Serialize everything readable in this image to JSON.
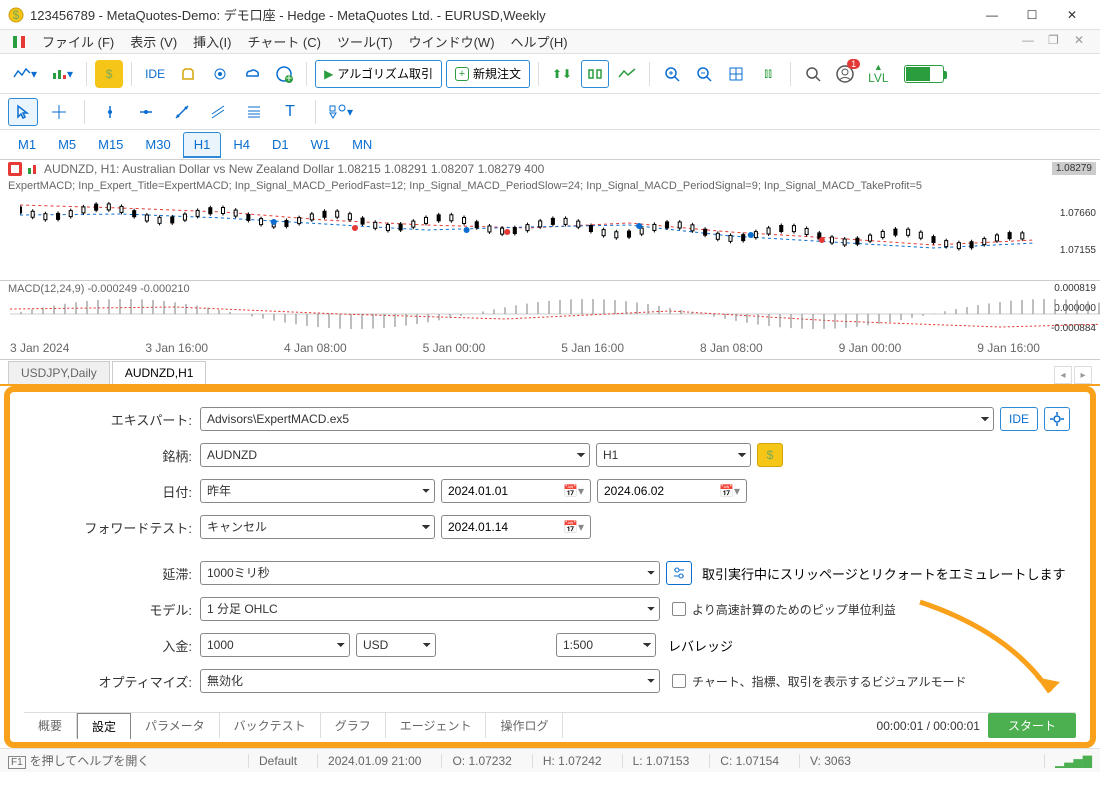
{
  "window": {
    "title": "123456789 - MetaQuotes-Demo: デモ口座 - Hedge - MetaQuotes Ltd. - EURUSD,Weekly"
  },
  "menu": {
    "file": "ファイル (F)",
    "view": "表示 (V)",
    "insert": "挿入(I)",
    "chart": "チャート (C)",
    "tool": "ツール(T)",
    "window": "ウインドウ(W)",
    "help": "ヘルプ(H)"
  },
  "toolbar": {
    "ide": "IDE",
    "algo": "アルゴリズム取引",
    "neworder": "新規注文",
    "notif_count": "1"
  },
  "timeframes": [
    "M1",
    "M5",
    "M15",
    "M30",
    "H1",
    "H4",
    "D1",
    "W1",
    "MN"
  ],
  "tf_active": "H1",
  "chart": {
    "header": "AUDNZD, H1:  Australian Dollar vs New Zealand Dollar  1.08215 1.08291 1.08207 1.08279  400",
    "expert_line": "ExpertMACD; Inp_Expert_Title=ExpertMACD; Inp_Signal_MACD_PeriodFast=12; Inp_Signal_MACD_PeriodSlow=24; Inp_Signal_MACD_PeriodSignal=9; Inp_Signal_MACD_TakeProfit=5",
    "price_hl": "1.08279",
    "price_2": "1.07660",
    "price_3": "1.07155",
    "macd_label": "MACD(12,24,9) -0.000249 -0.000210",
    "macd_v1": "0.000819",
    "macd_v2": "0.000000",
    "macd_v3": "-0.000884",
    "time_ticks": [
      "3 Jan 2024",
      "3 Jan 16:00",
      "4 Jan 08:00",
      "5 Jan 00:00",
      "5 Jan 16:00",
      "8 Jan 08:00",
      "9 Jan 00:00",
      "9 Jan 16:00"
    ]
  },
  "chart_tabs": {
    "inactive": "USDJPY,Daily",
    "active": "AUDNZD,H1"
  },
  "form": {
    "labels": {
      "expert": "エキスパート:",
      "symbol": "銘柄:",
      "date": "日付:",
      "forward": "フォワードテスト:",
      "delay": "延滞:",
      "model": "モデル:",
      "deposit": "入金:",
      "leverage": "レバレッジ",
      "optimize": "オプティマイズ:"
    },
    "expert": "Advisors\\ExpertMACD.ex5",
    "symbol": "AUDNZD",
    "period": "H1",
    "date_preset": "昨年",
    "date_from": "2024.01.01",
    "date_to": "2024.06.02",
    "forward": "キャンセル",
    "forward_date": "2024.01.14",
    "delay": "1000ミリ秒",
    "delay_note": "取引実行中にスリッページとリクォートをエミュレートします",
    "model": "1 分足 OHLC",
    "model_check": "より高速計算のためのピップ単位利益",
    "deposit": "1000",
    "currency": "USD",
    "leverage": "1:500",
    "optimize": "無効化",
    "visual_check": "チャート、指標、取引を表示するビジュアルモード",
    "ide_btn": "IDE"
  },
  "bottom_tabs": {
    "overview": "概要",
    "settings": "設定",
    "params": "パラメータ",
    "backtest": "バックテスト",
    "graph": "グラフ",
    "agent": "エージェント",
    "log": "操作ログ",
    "timer": "00:00:01 / 00:00:01",
    "start": "スタート"
  },
  "statusbar": {
    "help": "を押してヘルプを開く",
    "profile": "Default",
    "datetime": "2024.01.09 21:00",
    "o": "O: 1.07232",
    "h": "H: 1.07242",
    "l": "L: 1.07153",
    "c": "C: 1.07154",
    "v": "V: 3063"
  }
}
